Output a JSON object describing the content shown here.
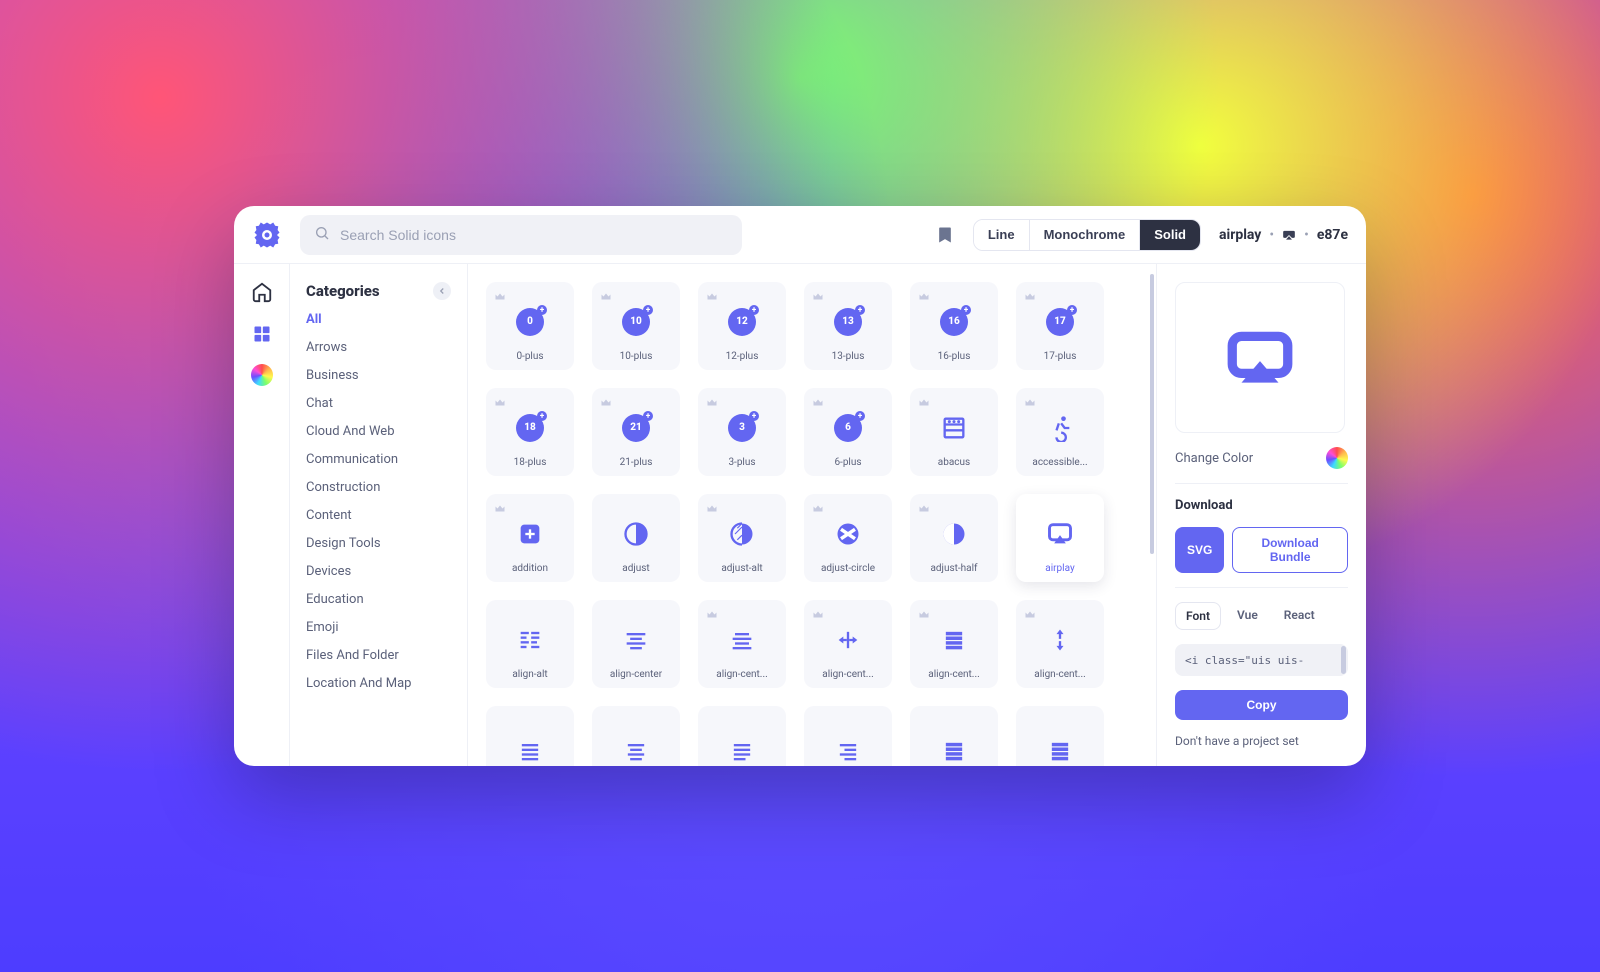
{
  "search": {
    "placeholder": "Search Solid icons"
  },
  "style_tabs": {
    "line": "Line",
    "monochrome": "Monochrome",
    "solid": "Solid",
    "active": "Solid"
  },
  "breadcrumb": {
    "name": "airplay",
    "code": "e87e"
  },
  "sidebar": {
    "title": "Categories",
    "items": [
      "All",
      "Arrows",
      "Business",
      "Chat",
      "Cloud And Web",
      "Communication",
      "Construction",
      "Content",
      "Design Tools",
      "Devices",
      "Education",
      "Emoji",
      "Files And Folder",
      "Location And Map"
    ],
    "active": "All"
  },
  "icons": [
    [
      {
        "label": "0-plus",
        "badge": "0",
        "pro": true
      },
      {
        "label": "10-plus",
        "badge": "10",
        "pro": true
      },
      {
        "label": "12-plus",
        "badge": "12",
        "pro": true
      },
      {
        "label": "13-plus",
        "badge": "13",
        "pro": true
      },
      {
        "label": "16-plus",
        "badge": "16",
        "pro": true
      },
      {
        "label": "17-plus",
        "badge": "17",
        "pro": true
      }
    ],
    [
      {
        "label": "18-plus",
        "badge": "18",
        "pro": true
      },
      {
        "label": "21-plus",
        "badge": "21",
        "pro": true
      },
      {
        "label": "3-plus",
        "badge": "3",
        "pro": true
      },
      {
        "label": "6-plus",
        "badge": "6",
        "pro": true
      },
      {
        "label": "abacus",
        "svg": "abacus",
        "pro": true
      },
      {
        "label": "accessible...",
        "svg": "accessible",
        "pro": true
      }
    ],
    [
      {
        "label": "addition",
        "svg": "addition",
        "pro": true
      },
      {
        "label": "adjust",
        "svg": "adjust",
        "pro": false
      },
      {
        "label": "adjust-alt",
        "svg": "adjust-alt",
        "pro": true
      },
      {
        "label": "adjust-circle",
        "svg": "adjust-circle",
        "pro": true
      },
      {
        "label": "adjust-half",
        "svg": "adjust-half",
        "pro": true
      },
      {
        "label": "airplay",
        "svg": "airplay",
        "pro": false,
        "selected": true
      }
    ],
    [
      {
        "label": "align-alt",
        "svg": "align-alt",
        "pro": false
      },
      {
        "label": "align-center",
        "svg": "align-center",
        "pro": false
      },
      {
        "label": "align-cent...",
        "svg": "align-center-h",
        "pro": true
      },
      {
        "label": "align-cent...",
        "svg": "align-center-arrows",
        "pro": true
      },
      {
        "label": "align-cent...",
        "svg": "align-center-fill",
        "pro": true
      },
      {
        "label": "align-cent...",
        "svg": "align-center-v",
        "pro": true
      }
    ],
    [
      {
        "label": "",
        "svg": "align-justify",
        "pro": false
      },
      {
        "label": "",
        "svg": "align-justify2",
        "pro": false
      },
      {
        "label": "",
        "svg": "align-justify3",
        "pro": false
      },
      {
        "label": "",
        "svg": "align-right",
        "pro": false
      },
      {
        "label": "",
        "svg": "align-fill",
        "pro": false
      },
      {
        "label": "",
        "svg": "align-fill2",
        "pro": false
      }
    ]
  ],
  "detail": {
    "change_color": "Change Color",
    "download": "Download",
    "svg_btn": "SVG",
    "bundle_btn": "Download Bundle",
    "tabs": {
      "font": "Font",
      "vue": "Vue",
      "react": "React",
      "active": "Font"
    },
    "code": "<i class=\"uis uis-",
    "copy": "Copy",
    "hint": "Don't have a project set"
  }
}
